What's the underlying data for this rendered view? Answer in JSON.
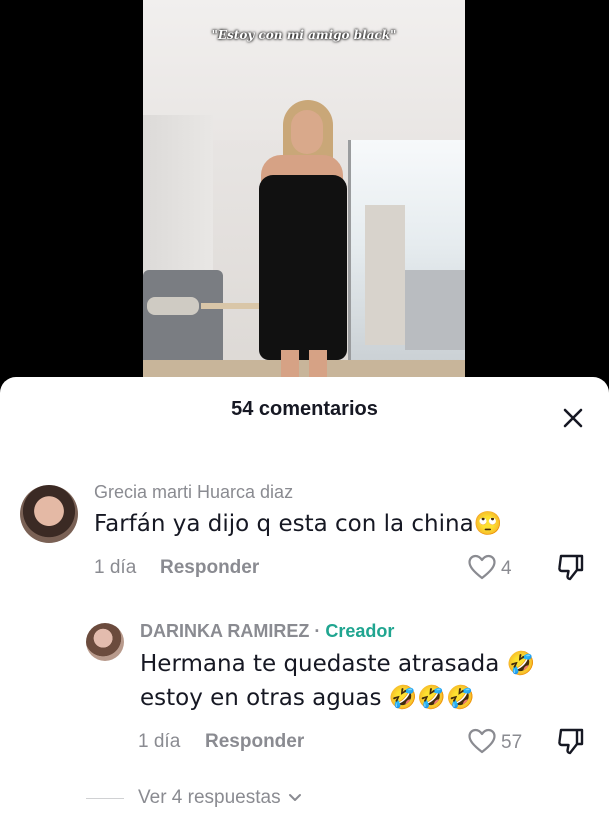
{
  "video": {
    "caption": "\"Estoy con mi amigo black\""
  },
  "comments_sheet": {
    "title": "54 comentarios",
    "close_icon": "close-icon",
    "comments": [
      {
        "username": "Grecia marti Huarca diaz",
        "text": "Farfán ya dijo q esta con la china🙄",
        "date": "1 día",
        "reply_label": "Responder",
        "likes": "4"
      },
      {
        "username": "DARINKA RAMIREZ",
        "separator": "·",
        "badge": "Creador",
        "text": "Hermana te quedaste atrasada 🤣 estoy en otras aguas 🤣🤣🤣",
        "date": "1 día",
        "reply_label": "Responder",
        "likes": "57"
      }
    ],
    "view_replies": "Ver 4 respuestas"
  },
  "colors": {
    "creator_badge": "#20a590",
    "meta_gray": "#8a8b91",
    "text_dark": "#161823"
  }
}
